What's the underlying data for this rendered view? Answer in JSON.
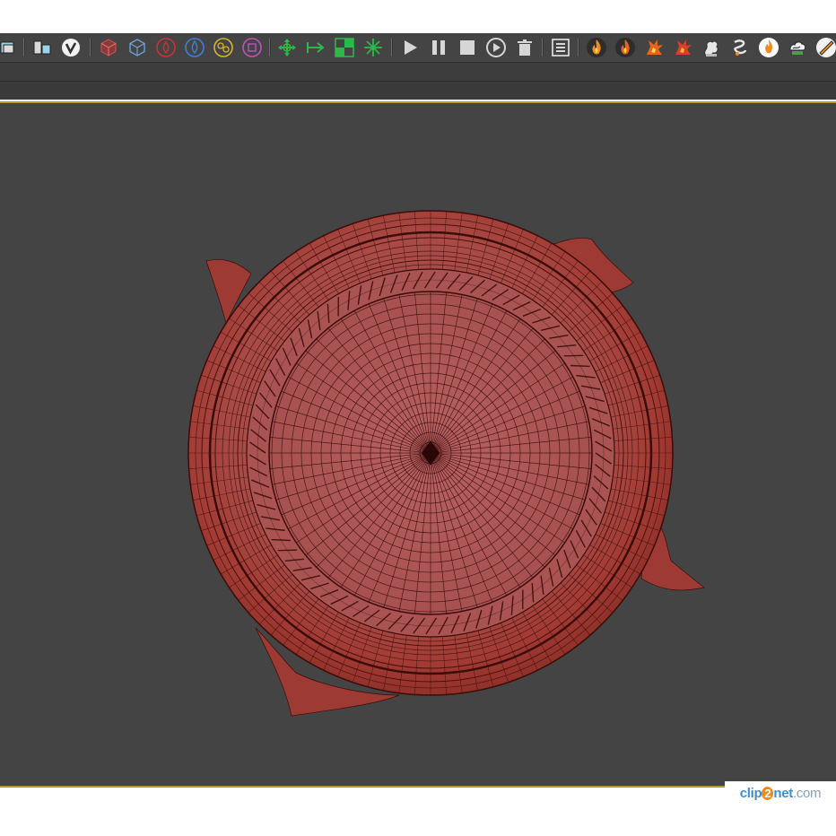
{
  "toolbar": {
    "groups": [
      {
        "name": "scene-tools",
        "icons": [
          "scene-layers-icon",
          "scene-explorer-icon",
          "vray-logo-icon"
        ]
      },
      {
        "name": "create-tools",
        "icons": [
          "box-icon",
          "wire-box-icon",
          "fire-circle-icon",
          "water-drop-icon",
          "particles-icon",
          "cube-circle-icon"
        ]
      },
      {
        "name": "transform-tools",
        "icons": [
          "move-gizmo-icon",
          "arrow-right-icon",
          "checker-grid-icon",
          "starburst-icon"
        ]
      },
      {
        "name": "playback",
        "icons": [
          "play-icon",
          "pause-icon",
          "stop-icon",
          "play-circle-icon",
          "trash-icon"
        ]
      },
      {
        "name": "simulation",
        "icons": [
          "list-icon",
          "fire-icon",
          "fire-icon",
          "explosion-icon",
          "explosion-icon",
          "smoke-icon",
          "smoke-icon",
          "flame-icon",
          "smoke-icon",
          "brush-icon"
        ]
      }
    ]
  },
  "viewport": {
    "border_color": "#b5962f",
    "background": "#444444",
    "object": {
      "name": "wireframe-pot-model",
      "color": "#a83e34",
      "wire_color": "#3b0c0a"
    }
  },
  "watermark": {
    "part1": "clip",
    "part2": "2",
    "part3": "net",
    "part4": ".com"
  }
}
